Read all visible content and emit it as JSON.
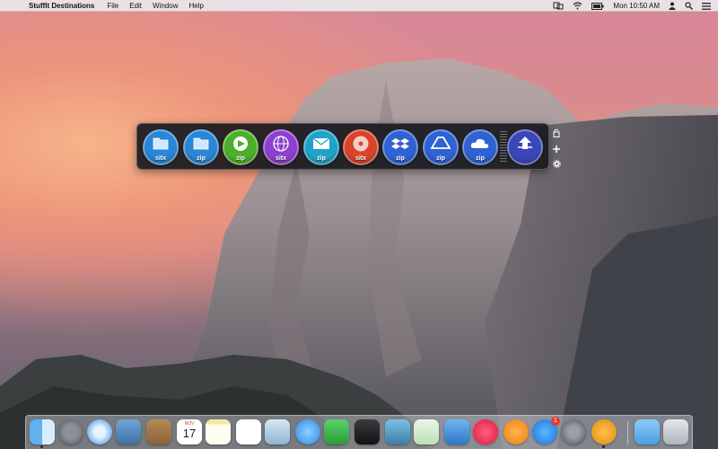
{
  "menubar": {
    "app_name": "StuffIt Destinations",
    "menus": [
      "File",
      "Edit",
      "Window",
      "Help"
    ],
    "clock": "Mon 10:50 AM"
  },
  "destinations": [
    {
      "label": "sitx",
      "icon": "folder-icon",
      "color": "#2a86d6"
    },
    {
      "label": "zip",
      "icon": "folder-icon",
      "color": "#2a86d6"
    },
    {
      "label": "zip",
      "icon": "play-icon",
      "color": "#4caf2a"
    },
    {
      "label": "sitx",
      "icon": "globe-icon",
      "color": "#8e3fcf"
    },
    {
      "label": "zip",
      "icon": "mail-icon",
      "color": "#1fa3c8"
    },
    {
      "label": "sitx",
      "icon": "disc-icon",
      "color": "#d9432b"
    },
    {
      "label": "zip",
      "icon": "dropbox-icon",
      "color": "#2f62d3"
    },
    {
      "label": "zip",
      "icon": "google-drive-icon",
      "color": "#2f62d3"
    },
    {
      "label": "zip",
      "icon": "cloud-icon",
      "color": "#2f62d3"
    },
    {
      "label": "",
      "icon": "upload-icon",
      "color": "#3a47b8"
    }
  ],
  "dock": {
    "calendar": {
      "month": "NOV",
      "day": "17"
    },
    "app_store_badge": "1",
    "icons": [
      "finder-icon",
      "launchpad-icon",
      "safari-icon",
      "mail-stamp-icon",
      "contacts-icon",
      "calendar-icon",
      "notes-icon",
      "reminders-icon",
      "preview-icon",
      "messages-icon",
      "facetime-icon",
      "photo-booth-icon",
      "iphoto-icon",
      "numbers-icon",
      "keynote-icon",
      "itunes-icon",
      "ibooks-icon",
      "app-store-icon",
      "system-preferences-icon",
      "stuffit-icon",
      "downloads-folder-icon",
      "trash-icon"
    ]
  }
}
